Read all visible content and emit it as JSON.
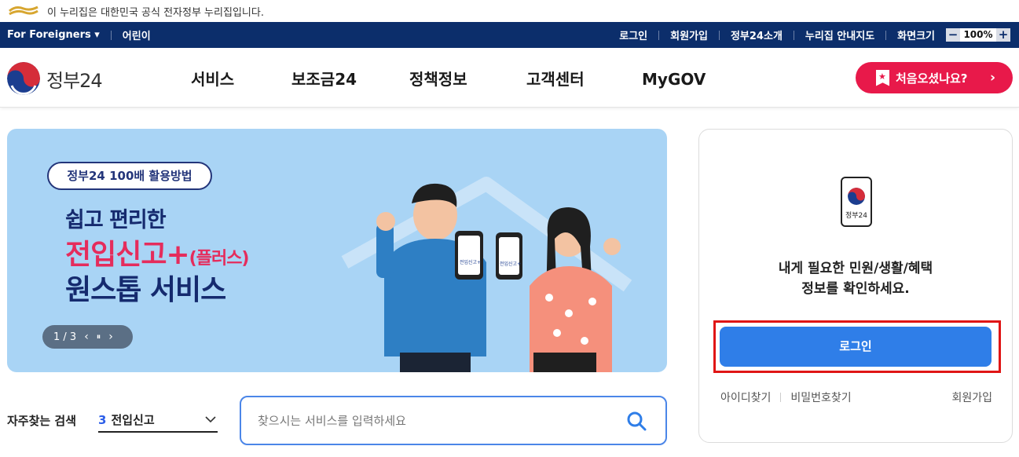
{
  "notice": {
    "text": "이 누리집은 대한민국 공식 전자정부 누리집입니다."
  },
  "util_bar": {
    "foreigners": "For Foreigners ▾",
    "kids": "어린이",
    "right_links": [
      "로그인",
      "회원가입",
      "정부24소개",
      "누리집 안내지도",
      "화면크기"
    ],
    "zoom_minus": "−",
    "zoom_value": "100%",
    "zoom_plus": "+"
  },
  "header": {
    "logo_text": "정부24",
    "nav": [
      "서비스",
      "보조금24",
      "정책정보",
      "고객센터",
      "MyGOV"
    ],
    "cta": {
      "label": "처음오셨나요?",
      "arrow": "›"
    }
  },
  "banner": {
    "pill": "정부24 100배 활용방법",
    "line1": "쉽고 편리한",
    "line2_main": "전입신고+",
    "line2_sub": "(플러스)",
    "line3": "원스톱 서비스",
    "phone_label": "전입신고+",
    "slider": {
      "page": "1 / 3",
      "prev": "‹",
      "pause": "⏸",
      "next": "›"
    }
  },
  "quick_search": {
    "label": "자주찾는 검색",
    "selected_num": "3",
    "selected_text": "전입신고",
    "chevron": "⌵"
  },
  "search": {
    "placeholder": "찾으시는 서비스를 입력하세요",
    "icon": "search-icon"
  },
  "login_panel": {
    "phone_label": "정부24",
    "message_line1": "내게 필요한 민원/생활/혜택",
    "message_line2": "정보를 확인하세요.",
    "login_button": "로그인",
    "links": [
      "아이디찾기",
      "비밀번호찾기"
    ],
    "join": "회원가입"
  },
  "colors": {
    "util_bg": "#0c2e6b",
    "cta": "#e8194a",
    "banner_bg": "#a9d4f5",
    "login_btn": "#2f7ee8",
    "highlight": "#e01515"
  }
}
